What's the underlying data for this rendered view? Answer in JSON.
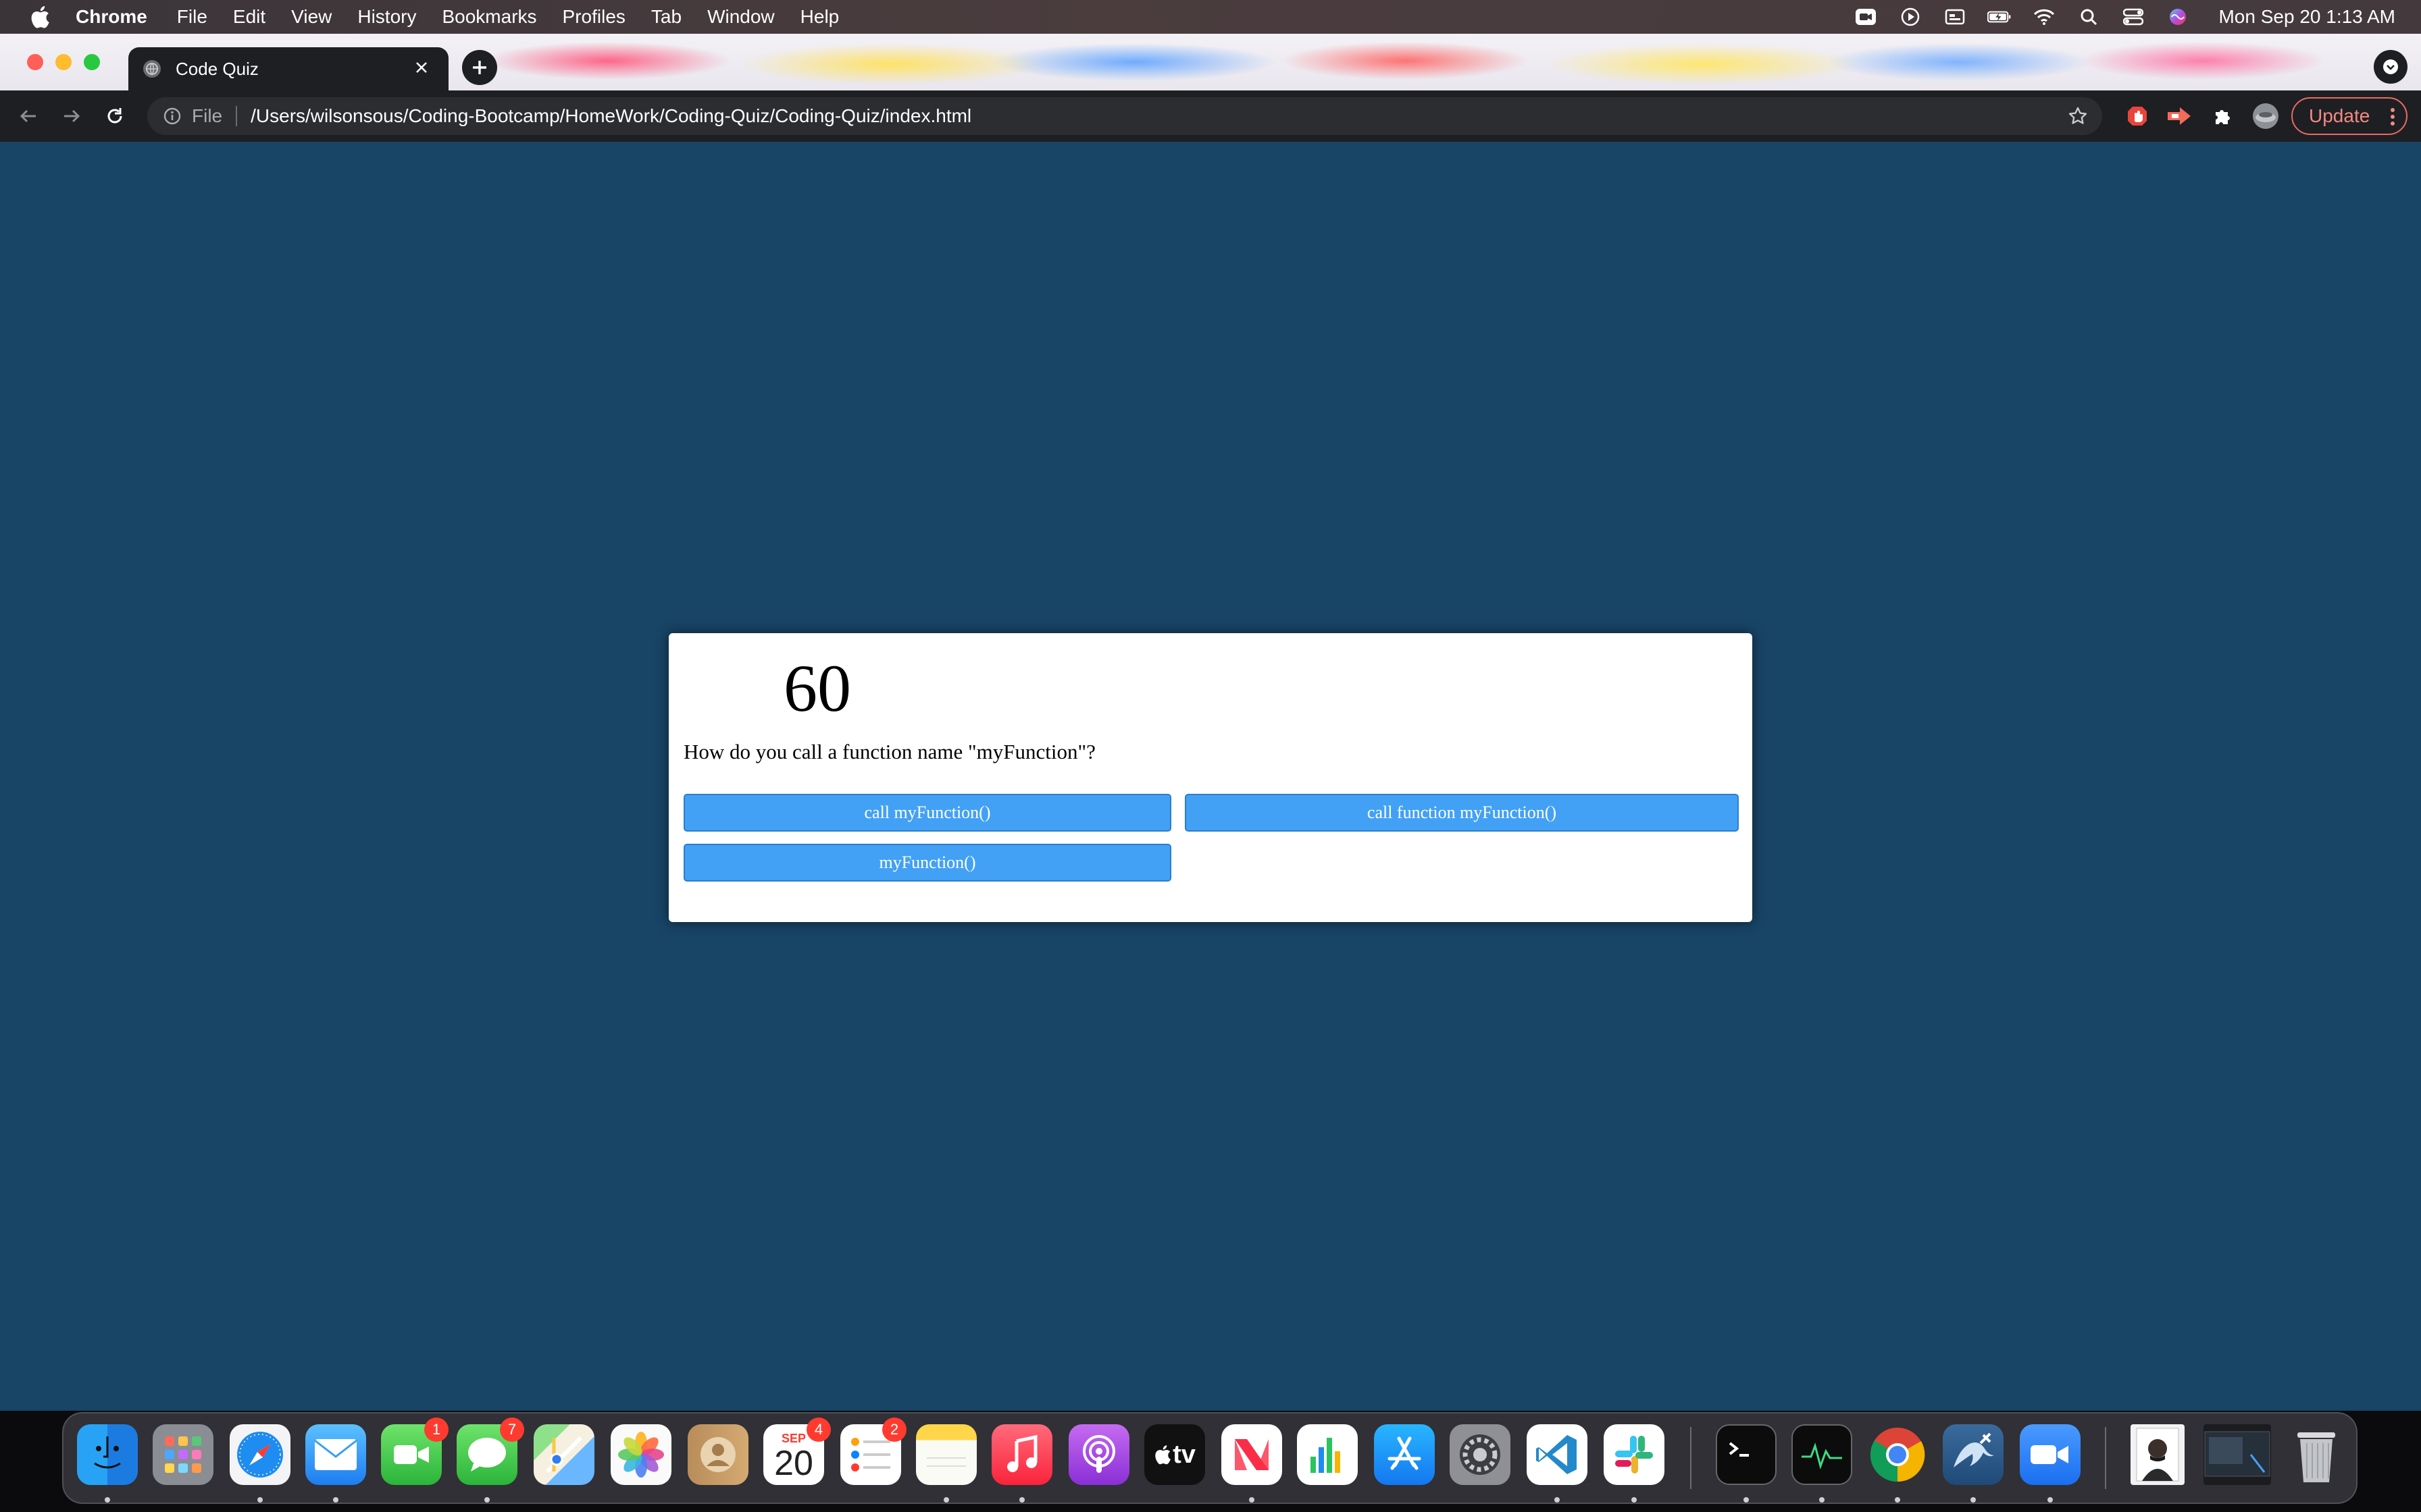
{
  "menubar": {
    "app_name": "Chrome",
    "items": [
      "File",
      "Edit",
      "View",
      "History",
      "Bookmarks",
      "Profiles",
      "Tab",
      "Window",
      "Help"
    ],
    "clock": "Mon Sep 20  1:13 AM"
  },
  "browser": {
    "tab_title": "Code Quiz",
    "url_scheme": "File",
    "url_path": "/Users/wilsonsous/Coding-Bootcamp/HomeWork/Coding-Quiz/Coding-Quiz/index.html",
    "update_label": "Update"
  },
  "quiz": {
    "timer": "60",
    "question": "How do you call a function name \"myFunction\"?",
    "answers": [
      "call myFunction()",
      "call function myFunction()",
      "myFunction()"
    ]
  },
  "dock": {
    "badges": {
      "facetime": "1",
      "messages": "7",
      "calendar": "4",
      "reminders": "2"
    },
    "calendar_month": "SEP",
    "calendar_day": "20",
    "appletv_label": "tv"
  },
  "colors": {
    "page_background": "#184466",
    "answer_button": "#42a1f5",
    "update_accent": "#f28b82"
  }
}
